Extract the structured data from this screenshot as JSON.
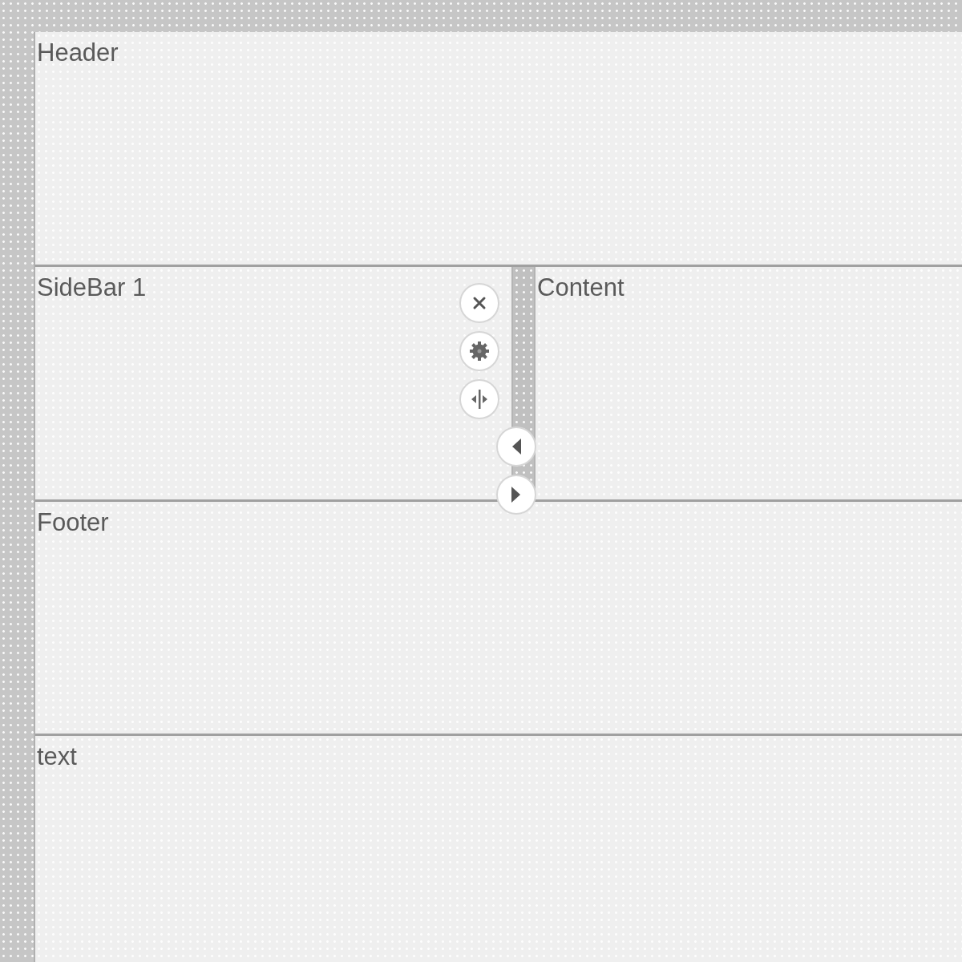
{
  "header": {
    "label": "Header"
  },
  "sidebar": {
    "label": "SideBar 1"
  },
  "content": {
    "label": "Content"
  },
  "footer": {
    "label": "Footer"
  },
  "text_panel": {
    "label": "text"
  },
  "splitter_tools": [
    {
      "kind": "close"
    },
    {
      "kind": "settings"
    },
    {
      "kind": "split"
    }
  ],
  "splitter_arrows": [
    {
      "kind": "left"
    },
    {
      "kind": "right"
    }
  ]
}
